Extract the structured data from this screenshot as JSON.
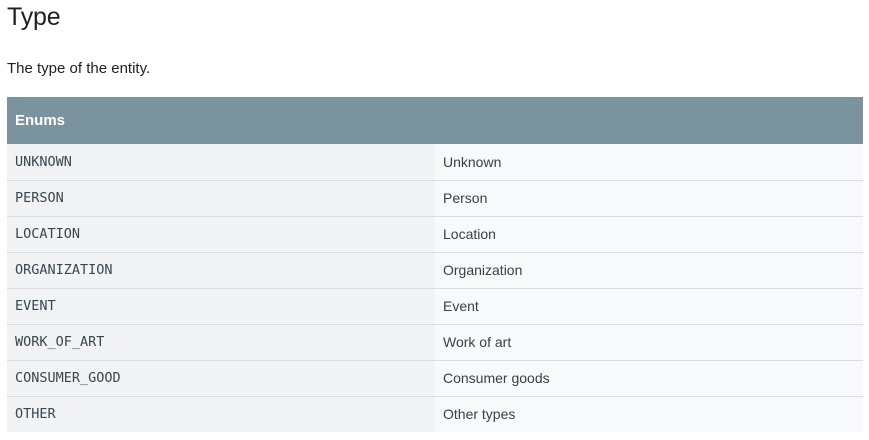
{
  "heading": "Type",
  "description": "The type of the entity.",
  "table": {
    "header": "Enums",
    "rows": [
      {
        "name": "UNKNOWN",
        "desc": "Unknown"
      },
      {
        "name": "PERSON",
        "desc": "Person"
      },
      {
        "name": "LOCATION",
        "desc": "Location"
      },
      {
        "name": "ORGANIZATION",
        "desc": "Organization"
      },
      {
        "name": "EVENT",
        "desc": "Event"
      },
      {
        "name": "WORK_OF_ART",
        "desc": "Work of art"
      },
      {
        "name": "CONSUMER_GOOD",
        "desc": "Consumer goods"
      },
      {
        "name": "OTHER",
        "desc": "Other types"
      }
    ]
  },
  "colors": {
    "header_bg": "#7a939e",
    "name_cell_bg": "#f1f3f4",
    "desc_cell_bg": "#f8f9fa"
  }
}
